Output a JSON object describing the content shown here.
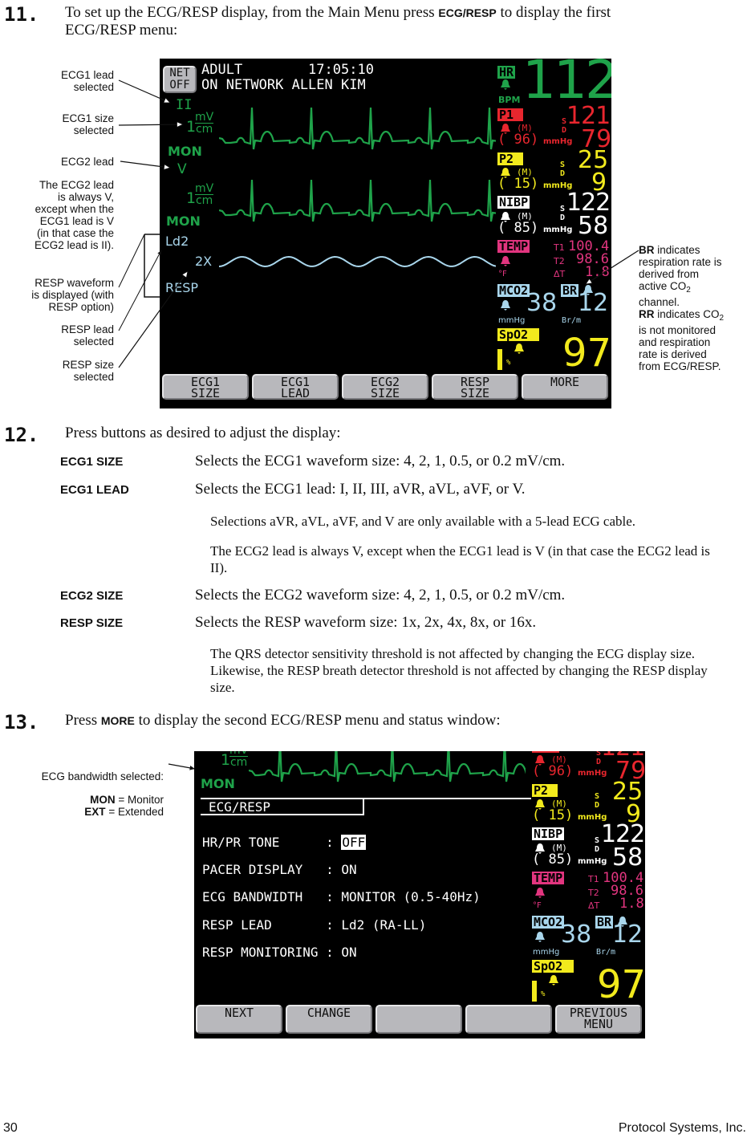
{
  "step11": {
    "number": "11.",
    "text_before": "To set up the ECG/RESP display, from the Main Menu press ",
    "keyword": "ECG/RESP",
    "text_after": " to display the first",
    "line2": "ECG/RESP menu:"
  },
  "screen1": {
    "net_button": [
      "NET",
      "OFF"
    ],
    "header_line1": "ADULT        17:05:10",
    "header_line2": "ON NETWORK ALLEN KIM",
    "ecg1": {
      "lead": "II",
      "size_num": "1",
      "size_unit_top": "mV",
      "size_unit_bottom": "cm",
      "bandwidth": "MON"
    },
    "ecg2": {
      "lead": "V",
      "size_num": "1",
      "size_unit_top": "mV",
      "size_unit_bottom": "cm",
      "bandwidth": "MON"
    },
    "resp": {
      "lead": "Ld2",
      "size": "2X",
      "label": "RESP"
    },
    "softkeys": [
      {
        "line1": "ECG1",
        "line2": "SIZE"
      },
      {
        "line1": "ECG1",
        "line2": "LEAD"
      },
      {
        "line1": "ECG2",
        "line2": "SIZE"
      },
      {
        "line1": "RESP",
        "line2": "SIZE"
      },
      {
        "line1": "MORE",
        "line2": ""
      }
    ]
  },
  "vitals": {
    "hr": {
      "tag": "HR",
      "unit": "BPM",
      "value": "112"
    },
    "p1": {
      "tag": "P1",
      "mean_label": "(M)",
      "mean": "( 96)",
      "unit": "mmHg",
      "s": "S",
      "d": "D",
      "sys": "121",
      "dia": "79"
    },
    "p2": {
      "tag": "P2",
      "mean_label": "(M)",
      "mean": "( 15)",
      "unit": "mmHg",
      "s": "S",
      "d": "D",
      "sys": "25",
      "dia": "9"
    },
    "nibp": {
      "tag": "NIBP",
      "mean_label": "(M)",
      "mean": "( 85)",
      "unit": "mmHg",
      "s": "S",
      "d": "D",
      "sys": "122",
      "dia": "58"
    },
    "temp": {
      "tag": "TEMP",
      "unit": "°F",
      "t1_label": "T1",
      "t1": "100.4",
      "t2_label": "T2",
      "t2": "98.6",
      "dt_label": "ΔT",
      "dt": "1.8"
    },
    "co2": {
      "tag": "MCO2",
      "value": "38",
      "unit": "mmHg"
    },
    "br": {
      "tag": "BR",
      "value": "12",
      "unit": "Br/m"
    },
    "spo2": {
      "tag": "SpO2",
      "unit": "%",
      "value": "97"
    }
  },
  "callouts_left": [
    [
      "ECG1 lead",
      "selected"
    ],
    [
      "ECG1 size",
      "selected"
    ],
    [
      "ECG2 lead"
    ],
    [
      "The ECG2 lead",
      "is always V,",
      "except when the",
      "ECG1 lead is V",
      "(in that case the",
      "ECG2 lead is II)."
    ],
    [
      "RESP waveform",
      "is displayed (with",
      "RESP option)"
    ],
    [
      "RESP lead",
      "selected"
    ],
    [
      "RESP size",
      "selected"
    ]
  ],
  "callout_right": {
    "br_bold": "BR",
    "br_text1": " indicates",
    "br_text2": "respiration rate is",
    "br_text3": "derived from",
    "br_text4": "active CO",
    "br_sub": "2",
    "br_text5": "channel.",
    "rr_bold": "RR",
    "rr_text1": " indicates CO",
    "rr_sub": "2",
    "rr_text2": "is not monitored",
    "rr_text3": "and respiration",
    "rr_text4": "rate is derived",
    "rr_text5": "from ECG/RESP."
  },
  "step12": {
    "number": "12.",
    "text": "Press buttons as desired to adjust the display:",
    "definitions": [
      {
        "term": "ECG1 SIZE",
        "desc": "Selects the ECG1 waveform size: 4, 2, 1, 0.5, or 0.2 mV/cm."
      },
      {
        "term": "ECG1 LEAD",
        "desc": "Selects the ECG1 lead: I, II, III, aVR, aVL, aVF, or V."
      },
      {
        "term": "ECG2 SIZE",
        "desc": "Selects the ECG2 waveform size: 4, 2, 1, 0.5, or 0.2 mV/cm."
      },
      {
        "term": "RESP SIZE",
        "desc": "Selects the RESP waveform size: 1x, 2x, 4x, 8x, or 16x."
      }
    ],
    "note1": "Selections aVR, aVL, aVF, and V are only available with a 5-lead ECG cable.",
    "note2": "The ECG2 lead is always V, except when the ECG1 lead is V (in that case the ECG2 lead is II).",
    "note3": "The QRS detector sensitivity threshold is not affected by changing the ECG display size. Likewise, the RESP breath detector threshold is not affected by changing the RESP display size."
  },
  "step13": {
    "number": "13.",
    "text_before": "Press ",
    "keyword": "MORE",
    "text_after": " to display the second ECG/RESP menu and status window:"
  },
  "callout_bandwidth": {
    "title": "ECG bandwidth selected:",
    "mon_bold": "MON",
    "mon_text": " = Monitor",
    "ext_bold": "EXT",
    "ext_text": " = Extended"
  },
  "screen2": {
    "ecg": {
      "size_num": "1",
      "size_unit_top": "mV",
      "size_unit_bottom": "cm",
      "bandwidth": "MON"
    },
    "window_title": "ECG/RESP",
    "rows": [
      {
        "label": "HR/PR TONE      ",
        "sep": ": ",
        "value": "OFF",
        "selected": true
      },
      {
        "label": "PACER DISPLAY   ",
        "sep": ": ",
        "value": "ON"
      },
      {
        "label": "ECG BANDWIDTH   ",
        "sep": ": ",
        "value": "MONITOR (0.5-40Hz)"
      },
      {
        "label": "RESP LEAD       ",
        "sep": ": ",
        "value": "Ld2 (RA-LL)"
      },
      {
        "label": "RESP MONITORING ",
        "sep": ": ",
        "value": "ON"
      }
    ],
    "softkeys": [
      {
        "line1": "NEXT",
        "line2": ""
      },
      {
        "line1": "CHANGE",
        "line2": ""
      },
      {
        "line1": "",
        "line2": ""
      },
      {
        "line1": "",
        "line2": ""
      },
      {
        "line1": "PREVIOUS",
        "line2": "MENU"
      }
    ]
  },
  "footer": {
    "page": "30",
    "company": "Protocol Systems, Inc."
  }
}
